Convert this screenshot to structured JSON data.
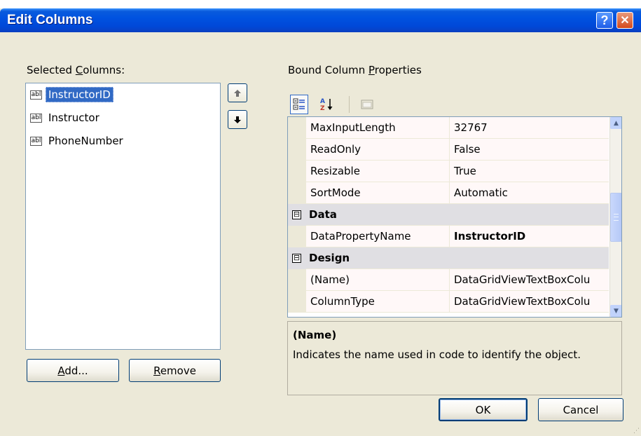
{
  "window": {
    "title": "Edit Columns",
    "help_glyph": "?",
    "close_glyph": "✕"
  },
  "selected_columns": {
    "label": "Selected Columns:",
    "items": [
      {
        "icon": "abl",
        "label": "InstructorID",
        "selected": true
      },
      {
        "icon": "abl",
        "label": "Instructor",
        "selected": false
      },
      {
        "icon": "abl",
        "label": "PhoneNumber",
        "selected": false
      }
    ],
    "move_up_icon": "arrow-up-icon",
    "move_down_icon": "arrow-down-icon"
  },
  "buttons": {
    "add": "Add...",
    "remove": "Remove",
    "ok": "OK",
    "cancel": "Cancel"
  },
  "properties": {
    "label": "Bound Column Properties",
    "toolbar": [
      "categorized-icon",
      "alphabetical-icon",
      "property-pages-icon"
    ],
    "rows": [
      {
        "name": "MaxInputLength",
        "value": "32767"
      },
      {
        "name": "ReadOnly",
        "value": "False"
      },
      {
        "name": "Resizable",
        "value": "True"
      },
      {
        "name": "SortMode",
        "value": "Automatic"
      },
      {
        "category": "Data",
        "expanded": true,
        "toggle": "⊟"
      },
      {
        "name": "DataPropertyName",
        "value": "InstructorID",
        "bold": true
      },
      {
        "category": "Design",
        "expanded": true,
        "toggle": "⊟"
      },
      {
        "name": "(Name)",
        "value": "DataGridViewTextBoxColu"
      },
      {
        "name": "ColumnType",
        "value": "DataGridViewTextBoxColu"
      }
    ],
    "scroll_fraction": 0.46
  },
  "description": {
    "title": "(Name)",
    "text": "Indicates the name used in code to identify the object."
  },
  "colors": {
    "titlebar": "#0054e3",
    "dialog_bg": "#ece9d8",
    "selection": "#316ac5",
    "category_bg": "#e0dfe3"
  }
}
